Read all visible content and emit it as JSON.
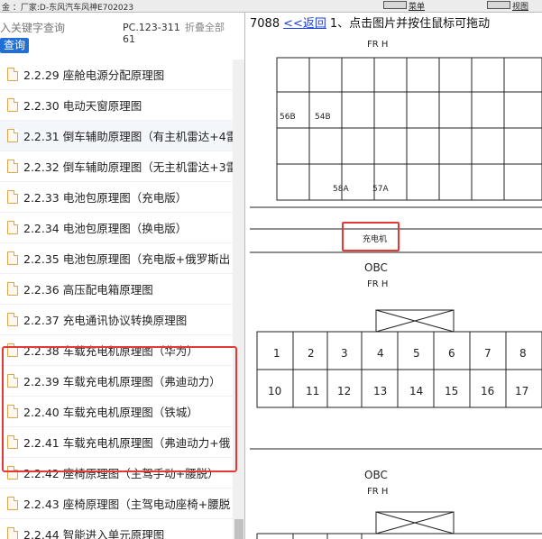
{
  "topbar": {
    "breadcrumb": "金 ：厂家:D-东风汽车风神E702023",
    "menu_label": "菜单",
    "picture_label": "视图"
  },
  "search": {
    "placeholder": "入关键字查询",
    "button_label": "查询",
    "pc_code": "PC.123-31161",
    "collapse_label": "折叠全部"
  },
  "tree": {
    "items": [
      {
        "label": "2.2.29 座舱电源分配原理图"
      },
      {
        "label": "2.2.30 电动天窗原理图"
      },
      {
        "label": "2.2.31 倒车辅助原理图（有主机雷达+4雷"
      },
      {
        "label": "2.2.32 倒车辅助原理图（无主机雷达+3雷"
      },
      {
        "label": "2.2.33 电池包原理图（充电版）"
      },
      {
        "label": "2.2.34 电池包原理图（换电版）"
      },
      {
        "label": "2.2.35 电池包原理图（充电版+俄罗斯出"
      },
      {
        "label": "2.2.36 高压配电箱原理图"
      },
      {
        "label": "2.2.37 充电通讯协议转换原理图"
      },
      {
        "label": "2.2.38 车载充电机原理图（华为）"
      },
      {
        "label": "2.2.39 车载充电机原理图（弗迪动力）"
      },
      {
        "label": "2.2.40 车载充电机原理图（铁城）"
      },
      {
        "label": "2.2.41 车载充电机原理图（弗迪动力+俄"
      },
      {
        "label": "2.2.42 座椅原理图（主驾手动+腰脱）"
      },
      {
        "label": "2.2.43 座椅原理图（主驾电动座椅+腰脱"
      },
      {
        "label": "2.2.44 智能进入单元原理图"
      }
    ]
  },
  "viewer": {
    "doc_number": "7088",
    "back_link": "<<返回",
    "instruction": "1、点击图片并按住鼠标可拖动",
    "diagram": {
      "top_label": "FR H",
      "pin_labels_row1": [
        "56B",
        "54B"
      ],
      "pin_labels_row2": [
        "58A",
        "57A"
      ],
      "highlight_label": "充电机",
      "block1_code": "OBC",
      "block1_sub": "FR H",
      "connector_row_top": [
        "1",
        "2",
        "3",
        "4",
        "5",
        "6",
        "7",
        "8"
      ],
      "connector_row_bottom": [
        "10",
        "11",
        "12",
        "13",
        "14",
        "15",
        "16",
        "17"
      ],
      "block2_code": "OBC",
      "block2_sub": "FR H"
    }
  },
  "colors": {
    "highlight_border": "#e53935",
    "search_button": "#1f6fd6",
    "link": "#1a3fe0",
    "file_icon": "#e2a34a"
  }
}
